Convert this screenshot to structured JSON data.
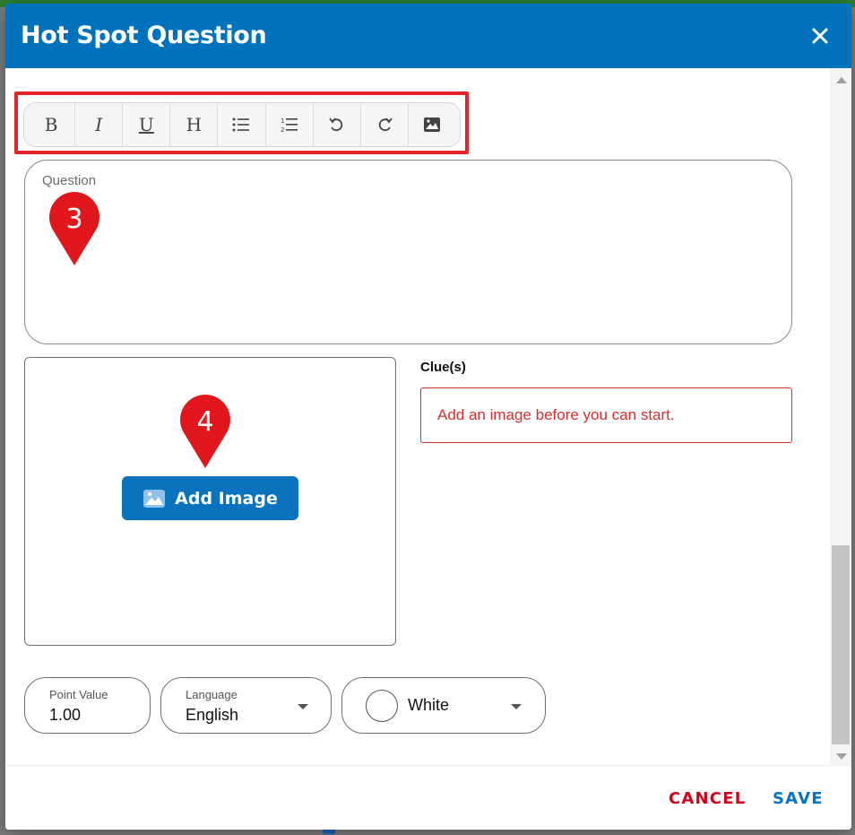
{
  "modal": {
    "title": "Hot Spot Question"
  },
  "toolbar": {
    "buttons": [
      {
        "name": "bold",
        "icon": "bold-icon",
        "glyph": "B"
      },
      {
        "name": "italic",
        "icon": "italic-icon",
        "glyph": "I"
      },
      {
        "name": "underline",
        "icon": "underline-icon",
        "glyph": "U"
      },
      {
        "name": "heading",
        "icon": "heading-icon",
        "glyph": "H"
      },
      {
        "name": "bullet-list",
        "icon": "bullet-list-icon"
      },
      {
        "name": "numbered-list",
        "icon": "numbered-list-icon"
      },
      {
        "name": "undo",
        "icon": "undo-icon"
      },
      {
        "name": "redo",
        "icon": "redo-icon"
      },
      {
        "name": "insert-image",
        "icon": "image-icon"
      }
    ]
  },
  "question": {
    "label": "Question",
    "value": ""
  },
  "markers": [
    {
      "number": "3",
      "color": "#e0171c"
    },
    {
      "number": "4",
      "color": "#e0171c"
    }
  ],
  "image_area": {
    "add_image_label": "Add Image"
  },
  "clues": {
    "label": "Clue(s)",
    "message": "Add an image before you can start."
  },
  "fields": {
    "point_value": {
      "label": "Point Value",
      "value": "1.00"
    },
    "language": {
      "label": "Language",
      "value": "English"
    },
    "color": {
      "value": "White"
    }
  },
  "footer": {
    "cancel_label": "CANCEL",
    "save_label": "SAVE"
  },
  "colors": {
    "header": "#0072bb",
    "primary_button": "#0a73be",
    "cancel": "#d0021b",
    "error": "#d32f2f",
    "highlight": "#e0252b"
  }
}
